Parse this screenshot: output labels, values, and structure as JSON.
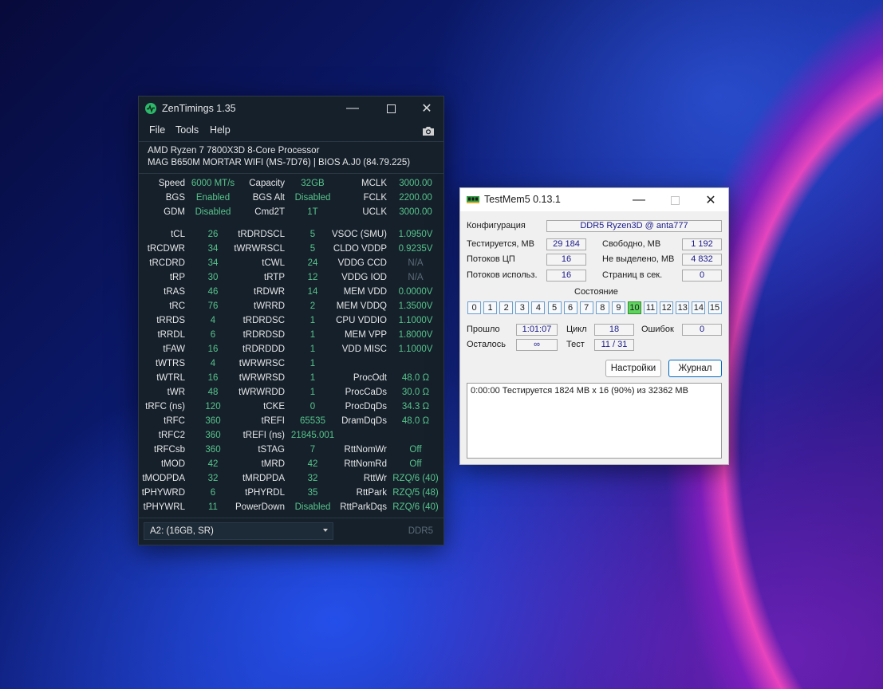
{
  "zentimings": {
    "title": "ZenTimings 1.35",
    "menu": [
      "File",
      "Tools",
      "Help"
    ],
    "cpu": "AMD Ryzen 7 7800X3D 8-Core Processor",
    "board": "MAG B650M MORTAR WIFI (MS-7D76) | BIOS A.J0 (84.79.225)",
    "summary": [
      [
        [
          "Speed",
          "6000 MT/s"
        ],
        [
          "Capacity",
          "32GB"
        ],
        [
          "MCLK",
          "3000.00"
        ]
      ],
      [
        [
          "BGS",
          "Enabled"
        ],
        [
          "BGS Alt",
          "Disabled"
        ],
        [
          "FCLK",
          "2200.00"
        ]
      ],
      [
        [
          "GDM",
          "Disabled"
        ],
        [
          "Cmd2T",
          "1T"
        ],
        [
          "UCLK",
          "3000.00"
        ]
      ]
    ],
    "timings": [
      [
        [
          "tCL",
          "26"
        ],
        [
          "tRDRDSCL",
          "5"
        ],
        [
          "VSOC (SMU)",
          "1.0950V"
        ]
      ],
      [
        [
          "tRCDWR",
          "34"
        ],
        [
          "tWRWRSCL",
          "5"
        ],
        [
          "CLDO VDDP",
          "0.9235V"
        ]
      ],
      [
        [
          "tRCDRD",
          "34"
        ],
        [
          "tCWL",
          "24"
        ],
        [
          "VDDG CCD",
          "N/A"
        ]
      ],
      [
        [
          "tRP",
          "30"
        ],
        [
          "tRTP",
          "12"
        ],
        [
          "VDDG IOD",
          "N/A"
        ]
      ],
      [
        [
          "tRAS",
          "46"
        ],
        [
          "tRDWR",
          "14"
        ],
        [
          "MEM VDD",
          "0.0000V"
        ]
      ],
      [
        [
          "tRC",
          "76"
        ],
        [
          "tWRRD",
          "2"
        ],
        [
          "MEM VDDQ",
          "1.3500V"
        ]
      ],
      [
        [
          "tRRDS",
          "4"
        ],
        [
          "tRDRDSC",
          "1"
        ],
        [
          "CPU VDDIO",
          "1.1000V"
        ]
      ],
      [
        [
          "tRRDL",
          "6"
        ],
        [
          "tRDRDSD",
          "1"
        ],
        [
          "MEM VPP",
          "1.8000V"
        ]
      ],
      [
        [
          "tFAW",
          "16"
        ],
        [
          "tRDRDDD",
          "1"
        ],
        [
          "VDD MISC",
          "1.1000V"
        ]
      ],
      [
        [
          "tWTRS",
          "4"
        ],
        [
          "tWRWRSC",
          "1"
        ],
        [
          "",
          ""
        ]
      ],
      [
        [
          "tWTRL",
          "16"
        ],
        [
          "tWRWRSD",
          "1"
        ],
        [
          "ProcOdt",
          "48.0 Ω"
        ]
      ],
      [
        [
          "tWR",
          "48"
        ],
        [
          "tWRWRDD",
          "1"
        ],
        [
          "ProcCaDs",
          "30.0 Ω"
        ]
      ],
      [
        [
          "tRFC (ns)",
          "120"
        ],
        [
          "tCKE",
          "0"
        ],
        [
          "ProcDqDs",
          "34.3 Ω"
        ]
      ],
      [
        [
          "tRFC",
          "360"
        ],
        [
          "tREFI",
          "65535"
        ],
        [
          "DramDqDs",
          "48.0 Ω"
        ]
      ],
      [
        [
          "tRFC2",
          "360"
        ],
        [
          "tREFI (ns)",
          "21845.001"
        ],
        [
          "",
          ""
        ]
      ],
      [
        [
          "tRFCsb",
          "360"
        ],
        [
          "tSTAG",
          "7"
        ],
        [
          "RttNomWr",
          "Off"
        ]
      ],
      [
        [
          "tMOD",
          "42"
        ],
        [
          "tMRD",
          "42"
        ],
        [
          "RttNomRd",
          "Off"
        ]
      ],
      [
        [
          "tMODPDA",
          "32"
        ],
        [
          "tMRDPDA",
          "32"
        ],
        [
          "RttWr",
          "RZQ/6 (40)"
        ]
      ],
      [
        [
          "tPHYWRD",
          "6"
        ],
        [
          "tPHYRDL",
          "35"
        ],
        [
          "RttPark",
          "RZQ/5 (48)"
        ]
      ],
      [
        [
          "tPHYWRL",
          "11"
        ],
        [
          "PowerDown",
          "Disabled"
        ],
        [
          "RttParkDqs",
          "RZQ/6 (40)"
        ]
      ]
    ],
    "dimm": "A2:  (16GB, SR)",
    "mem_type": "DDR5",
    "accent": "#58c48a"
  },
  "testmem": {
    "title": "TestMem5  0.13.1",
    "config_label": "Конфигурация",
    "config_value": "DDR5 Ryzen3D @ anta777",
    "rows": [
      {
        "l1": "Тестируется, МВ",
        "v1": "29 184",
        "l2": "Свободно, МВ",
        "v2": "1 192"
      },
      {
        "l1": "Потоков ЦП",
        "v1": "16",
        "l2": "Не выделено, МВ",
        "v2": "4 832"
      },
      {
        "l1": "Потоков использ.",
        "v1": "16",
        "l2": "Страниц в сек.",
        "v2": "0"
      }
    ],
    "state_label": "Состояние",
    "threads": [
      "0",
      "1",
      "2",
      "3",
      "4",
      "5",
      "6",
      "7",
      "8",
      "9",
      "10",
      "11",
      "12",
      "13",
      "14",
      "15"
    ],
    "active_thread": "10",
    "elapsed_label": "Прошло",
    "elapsed": "1:01:07",
    "cycle_label": "Цикл",
    "cycle": "18",
    "errors_label": "Ошибок",
    "errors": "0",
    "remaining_label": "Осталось",
    "remaining": "∞",
    "test_label": "Тест",
    "test": "11 / 31",
    "settings_button": "Настройки",
    "log_button": "Журнал",
    "log_text": "0:00:00  Тестируется 1824 МВ x 16 (90%) из 32362 МВ",
    "active_color": "#5fd35f"
  }
}
